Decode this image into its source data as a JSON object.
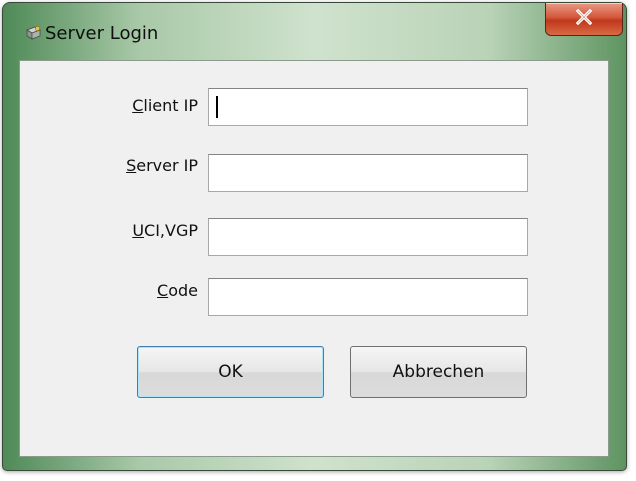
{
  "window": {
    "title": "Server Login",
    "icon": "server-login-app-icon",
    "close_icon": "close-x-icon"
  },
  "fields": [
    {
      "label_accel": "C",
      "label_rest": "lient IP",
      "value": "",
      "focused": true
    },
    {
      "label_accel": "S",
      "label_rest": "erver IP",
      "value": "",
      "focused": false
    },
    {
      "label_accel": "U",
      "label_rest": "CI,VGP",
      "value": "",
      "focused": false
    },
    {
      "label_accel": "C",
      "label_rest": "ode",
      "value": "",
      "focused": false
    }
  ],
  "buttons": {
    "ok_label": "OK",
    "cancel_label": "Abbrechen"
  },
  "colors": {
    "close_button": "#c9452a",
    "frame_green": "#a9c9a8",
    "client_bg": "#f0f0f0"
  }
}
